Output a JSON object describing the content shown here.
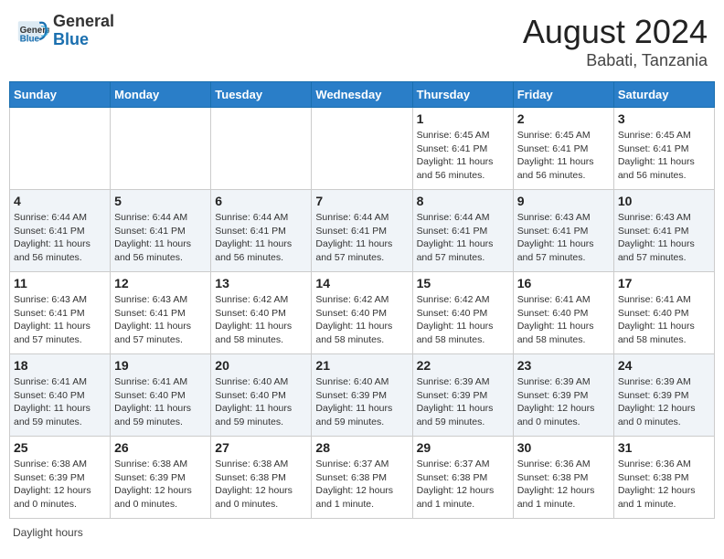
{
  "header": {
    "logo_general": "General",
    "logo_blue": "Blue",
    "month_title": "August 2024",
    "location": "Babati, Tanzania"
  },
  "weekdays": [
    "Sunday",
    "Monday",
    "Tuesday",
    "Wednesday",
    "Thursday",
    "Friday",
    "Saturday"
  ],
  "legend": "Daylight hours",
  "weeks": [
    [
      {
        "day": "",
        "info": ""
      },
      {
        "day": "",
        "info": ""
      },
      {
        "day": "",
        "info": ""
      },
      {
        "day": "",
        "info": ""
      },
      {
        "day": "1",
        "info": "Sunrise: 6:45 AM\nSunset: 6:41 PM\nDaylight: 11 hours\nand 56 minutes."
      },
      {
        "day": "2",
        "info": "Sunrise: 6:45 AM\nSunset: 6:41 PM\nDaylight: 11 hours\nand 56 minutes."
      },
      {
        "day": "3",
        "info": "Sunrise: 6:45 AM\nSunset: 6:41 PM\nDaylight: 11 hours\nand 56 minutes."
      }
    ],
    [
      {
        "day": "4",
        "info": "Sunrise: 6:44 AM\nSunset: 6:41 PM\nDaylight: 11 hours\nand 56 minutes."
      },
      {
        "day": "5",
        "info": "Sunrise: 6:44 AM\nSunset: 6:41 PM\nDaylight: 11 hours\nand 56 minutes."
      },
      {
        "day": "6",
        "info": "Sunrise: 6:44 AM\nSunset: 6:41 PM\nDaylight: 11 hours\nand 56 minutes."
      },
      {
        "day": "7",
        "info": "Sunrise: 6:44 AM\nSunset: 6:41 PM\nDaylight: 11 hours\nand 57 minutes."
      },
      {
        "day": "8",
        "info": "Sunrise: 6:44 AM\nSunset: 6:41 PM\nDaylight: 11 hours\nand 57 minutes."
      },
      {
        "day": "9",
        "info": "Sunrise: 6:43 AM\nSunset: 6:41 PM\nDaylight: 11 hours\nand 57 minutes."
      },
      {
        "day": "10",
        "info": "Sunrise: 6:43 AM\nSunset: 6:41 PM\nDaylight: 11 hours\nand 57 minutes."
      }
    ],
    [
      {
        "day": "11",
        "info": "Sunrise: 6:43 AM\nSunset: 6:41 PM\nDaylight: 11 hours\nand 57 minutes."
      },
      {
        "day": "12",
        "info": "Sunrise: 6:43 AM\nSunset: 6:41 PM\nDaylight: 11 hours\nand 57 minutes."
      },
      {
        "day": "13",
        "info": "Sunrise: 6:42 AM\nSunset: 6:40 PM\nDaylight: 11 hours\nand 58 minutes."
      },
      {
        "day": "14",
        "info": "Sunrise: 6:42 AM\nSunset: 6:40 PM\nDaylight: 11 hours\nand 58 minutes."
      },
      {
        "day": "15",
        "info": "Sunrise: 6:42 AM\nSunset: 6:40 PM\nDaylight: 11 hours\nand 58 minutes."
      },
      {
        "day": "16",
        "info": "Sunrise: 6:41 AM\nSunset: 6:40 PM\nDaylight: 11 hours\nand 58 minutes."
      },
      {
        "day": "17",
        "info": "Sunrise: 6:41 AM\nSunset: 6:40 PM\nDaylight: 11 hours\nand 58 minutes."
      }
    ],
    [
      {
        "day": "18",
        "info": "Sunrise: 6:41 AM\nSunset: 6:40 PM\nDaylight: 11 hours\nand 59 minutes."
      },
      {
        "day": "19",
        "info": "Sunrise: 6:41 AM\nSunset: 6:40 PM\nDaylight: 11 hours\nand 59 minutes."
      },
      {
        "day": "20",
        "info": "Sunrise: 6:40 AM\nSunset: 6:40 PM\nDaylight: 11 hours\nand 59 minutes."
      },
      {
        "day": "21",
        "info": "Sunrise: 6:40 AM\nSunset: 6:39 PM\nDaylight: 11 hours\nand 59 minutes."
      },
      {
        "day": "22",
        "info": "Sunrise: 6:39 AM\nSunset: 6:39 PM\nDaylight: 11 hours\nand 59 minutes."
      },
      {
        "day": "23",
        "info": "Sunrise: 6:39 AM\nSunset: 6:39 PM\nDaylight: 12 hours\nand 0 minutes."
      },
      {
        "day": "24",
        "info": "Sunrise: 6:39 AM\nSunset: 6:39 PM\nDaylight: 12 hours\nand 0 minutes."
      }
    ],
    [
      {
        "day": "25",
        "info": "Sunrise: 6:38 AM\nSunset: 6:39 PM\nDaylight: 12 hours\nand 0 minutes."
      },
      {
        "day": "26",
        "info": "Sunrise: 6:38 AM\nSunset: 6:39 PM\nDaylight: 12 hours\nand 0 minutes."
      },
      {
        "day": "27",
        "info": "Sunrise: 6:38 AM\nSunset: 6:38 PM\nDaylight: 12 hours\nand 0 minutes."
      },
      {
        "day": "28",
        "info": "Sunrise: 6:37 AM\nSunset: 6:38 PM\nDaylight: 12 hours\nand 1 minute."
      },
      {
        "day": "29",
        "info": "Sunrise: 6:37 AM\nSunset: 6:38 PM\nDaylight: 12 hours\nand 1 minute."
      },
      {
        "day": "30",
        "info": "Sunrise: 6:36 AM\nSunset: 6:38 PM\nDaylight: 12 hours\nand 1 minute."
      },
      {
        "day": "31",
        "info": "Sunrise: 6:36 AM\nSunset: 6:38 PM\nDaylight: 12 hours\nand 1 minute."
      }
    ]
  ]
}
